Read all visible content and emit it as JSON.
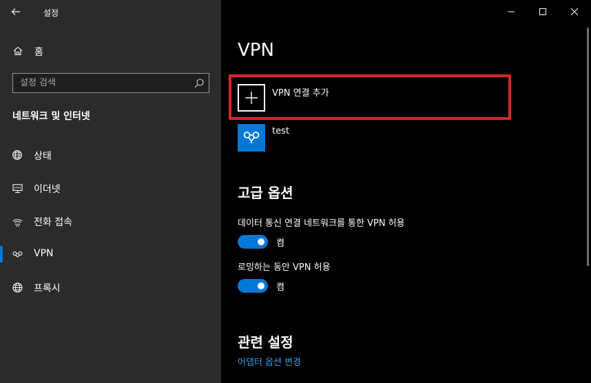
{
  "window": {
    "app_title": "설정"
  },
  "sidebar": {
    "home_label": "홈",
    "search_placeholder": "설정 검색",
    "section_title": "네트워크 및 인터넷",
    "items": [
      {
        "label": "상태",
        "icon": "globe-status-icon",
        "active": false
      },
      {
        "label": "이더넷",
        "icon": "ethernet-icon",
        "active": false
      },
      {
        "label": "전화 접속",
        "icon": "dialup-icon",
        "active": false
      },
      {
        "label": "VPN",
        "icon": "vpn-icon",
        "active": true
      },
      {
        "label": "프록시",
        "icon": "globe-icon",
        "active": false
      }
    ]
  },
  "main": {
    "title": "VPN",
    "add_connection_label": "VPN 연결 추가",
    "connections": [
      {
        "name": "test",
        "icon": "vpn-icon"
      }
    ],
    "advanced_title": "고급 옵션",
    "options": [
      {
        "label": "데이터 통신 연결 네트워크를 통한 VPN 허용",
        "state": "켬",
        "on": true
      },
      {
        "label": "로밍하는 동안 VPN 허용",
        "state": "켬",
        "on": true
      }
    ],
    "related_title": "관련 설정",
    "related_link": "어댑터 옵션 변경"
  },
  "colors": {
    "accent": "#0078d7",
    "highlight": "#d9262b",
    "link": "#3a9be8",
    "sidebar_bg": "#2b2b2b"
  }
}
